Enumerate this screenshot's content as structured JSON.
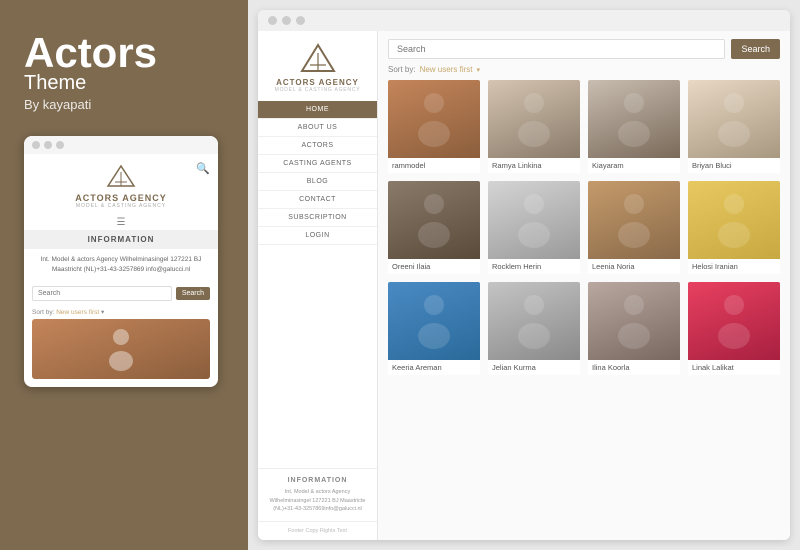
{
  "left_panel": {
    "title": "Actors",
    "subtitle": "Theme",
    "author": "By kayapati"
  },
  "mobile_preview": {
    "dots": [
      "dot1",
      "dot2",
      "dot3"
    ],
    "logo_text": "ACTORS AGENCY",
    "logo_sub": "MODEL & CASTING AGENCY",
    "info_header": "INFORMATION",
    "info_text": "Int. Model & actors Agency\nWilhelminasingel 127221 BJ Maastricht\n(NL)+31-43-3257869\ninfo@galucci.nl",
    "search_placeholder": "Search",
    "search_btn": "Search",
    "sort_label": "Sort by:",
    "sort_value": "New users first"
  },
  "browser": {
    "dots": [
      "dot1",
      "dot2",
      "dot3"
    ],
    "logo_text": "ACTORS AGENCY",
    "logo_sub": "MODEL & CASTING AGENCY",
    "nav_items": [
      {
        "label": "HOME",
        "active": true
      },
      {
        "label": "ABOUT US",
        "active": false
      },
      {
        "label": "ACTORS",
        "active": false
      },
      {
        "label": "CASTING AGENTS",
        "active": false
      },
      {
        "label": "BLOG",
        "active": false
      },
      {
        "label": "CONTACT",
        "active": false
      },
      {
        "label": "SUBSCRIPTION",
        "active": false
      },
      {
        "label": "LOGIN",
        "active": false
      }
    ],
    "info_section": {
      "title": "INFORMATION",
      "text": "Int. Model & actors Agency Wilhelminasingel 127221 BJ Maastricte (NL)+31-43-3257869info@galucci.nl"
    },
    "footer_text": "Footer Copy Rights Text",
    "search_placeholder": "Search",
    "search_btn": "Search",
    "sort_label": "Sort by:",
    "sort_value": "New users first",
    "actors": [
      {
        "name": "rammodel",
        "img_class": "img-1"
      },
      {
        "name": "Ramya Linkina",
        "img_class": "img-2"
      },
      {
        "name": "Kiayaram",
        "img_class": "img-3"
      },
      {
        "name": "Briyan Bluci",
        "img_class": "img-4"
      },
      {
        "name": "Oreeni Ilaia",
        "img_class": "img-5"
      },
      {
        "name": "Rocklem Herin",
        "img_class": "img-6"
      },
      {
        "name": "Leenia Noria",
        "img_class": "img-7"
      },
      {
        "name": "Helosi Iranian",
        "img_class": "img-8"
      },
      {
        "name": "Keeria Areman",
        "img_class": "img-9"
      },
      {
        "name": "Jelian Kurma",
        "img_class": "img-10"
      },
      {
        "name": "Ilina Koorla",
        "img_class": "img-11"
      },
      {
        "name": "Linak Lalikat",
        "img_class": "img-12"
      }
    ]
  },
  "colors": {
    "brand": "#7d6a4f",
    "accent": "#c8a96e",
    "nav_active_bg": "#7d6a4f",
    "search_btn_bg": "#7d6a4f"
  }
}
